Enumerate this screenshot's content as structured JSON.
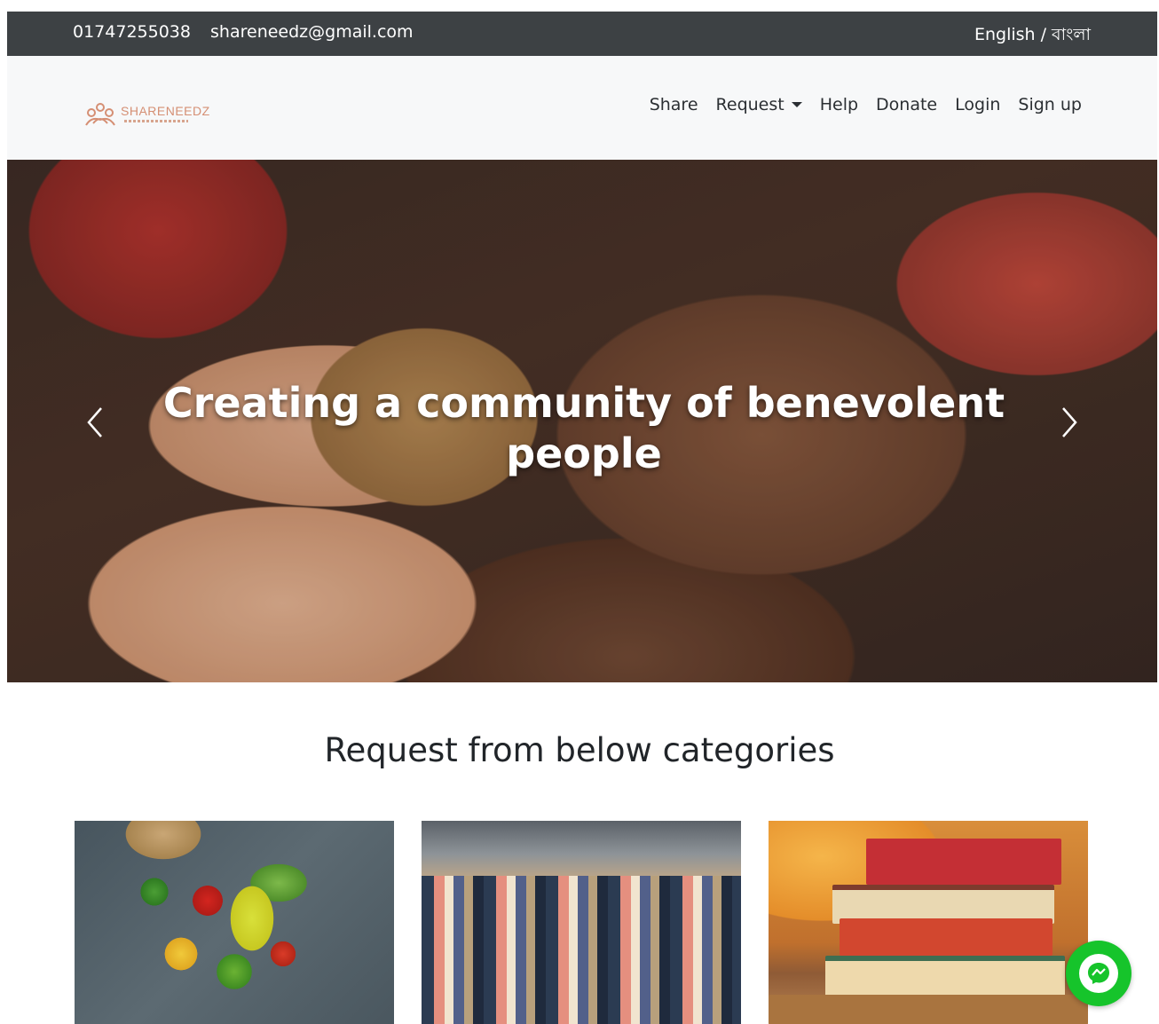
{
  "topbar": {
    "phone": "01747255038",
    "email": "shareneedz@gmail.com",
    "language": "English / বাংলা"
  },
  "navbar": {
    "logo_text": "SHARENEEDZ",
    "items": [
      "Share",
      "Request",
      "Help",
      "Donate",
      "Login",
      "Sign up"
    ]
  },
  "hero": {
    "caption": "Creating a community of benevolent people",
    "prev_icon": "chevron-left-icon",
    "next_icon": "chevron-right-icon"
  },
  "categories": {
    "title": "Request from below categories",
    "cards": [
      "food-category-image",
      "clothes-category-image",
      "books-category-image"
    ]
  },
  "chat": {
    "icon": "messenger-icon",
    "color": "#16c42b"
  },
  "colors": {
    "topbar_bg": "#3d4144",
    "navbar_bg": "#f7f8f9",
    "logo_accent": "#d58f74"
  }
}
